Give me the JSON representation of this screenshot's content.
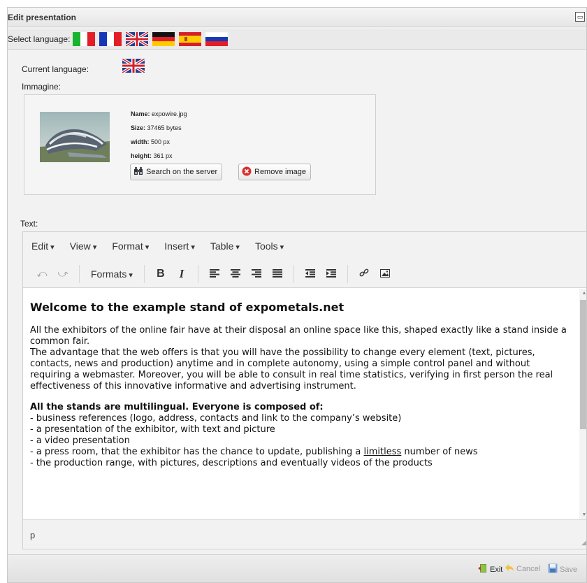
{
  "window": {
    "title": "Edit presentation"
  },
  "language_bar": {
    "label": "Select language:",
    "flags": [
      "italian-flag",
      "french-flag",
      "uk-flag",
      "german-flag",
      "spanish-flag",
      "russian-flag"
    ]
  },
  "current_language": {
    "label": "Current language:",
    "flag": "uk-flag"
  },
  "image": {
    "label": "Immagine:",
    "name_label": "Name:",
    "name_value": "expowire.jpg",
    "size_label": "Size:",
    "size_value": "37465 bytes",
    "width_label": "width:",
    "width_value": "500 px",
    "height_label": "height:",
    "height_value": "361 px",
    "search_button": "Search on the server",
    "remove_button": "Remove image"
  },
  "text_label": "Text:",
  "editor": {
    "menu": [
      "Edit",
      "View",
      "Format",
      "Insert",
      "Table",
      "Tools"
    ],
    "formats_label": "Formats",
    "bold_label": "B",
    "italic_label": "I",
    "status_path": "p",
    "content": {
      "heading": "Welcome to the example stand of expometals.net",
      "para1": "All the exhibitors of the online fair have at their disposal an online space like this, shaped exactly like a stand inside a common fair.",
      "para2": "The advantage that the web offers is that you will have the possibility to change every element (text, pictures, contacts, news and production) anytime and in complete autonomy, using a simple control panel and without requiring a webmaster. Moreover, you will be able to consult in real time statistics, verifying in first person the real effectiveness of this innovative informative and advertising instrument.",
      "list_heading": "All the stands are multilingual. Everyone is composed of:",
      "item1": "- business references (logo, address, contacts and link to the company’s website)",
      "item2": "- a presentation of the exhibitor, with text and picture",
      "item3": "- a video presentation",
      "item4_before": "- a press room, that the exhibitor has the chance to update, publishing a ",
      "item4_link": "limitless",
      "item4_after": " number of news",
      "item5": "- the production range, with pictures, descriptions and eventually videos of the products"
    }
  },
  "footer": {
    "exit": "Exit",
    "cancel": "Cancel",
    "save": "Save"
  }
}
